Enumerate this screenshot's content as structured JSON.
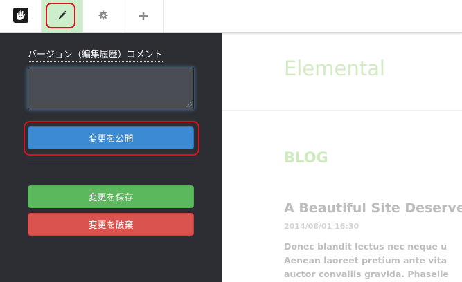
{
  "toolbar": {
    "logo_icon": "concrete5-hand-icon",
    "edit_icon": "pencil-icon",
    "settings_icon": "gear-icon",
    "add_icon": "plus-icon",
    "active_color": "#cdeeca",
    "highlight_color": "#d8131d"
  },
  "panel": {
    "version_comment_label": "バージョン（編集履歴）コメント",
    "comment_value": "",
    "publish_label": "変更を公開",
    "save_label": "変更を保存",
    "discard_label": "変更を破棄",
    "colors": {
      "publish": "#3b8ad2",
      "save": "#5cb85c",
      "discard": "#d9534f",
      "background": "#2c2e33"
    }
  },
  "site": {
    "title": "Elemental",
    "section_heading": "BLOG",
    "post": {
      "title": "A Beautiful Site Deserve",
      "date": "2014/08/01 16:30",
      "excerpt_lines": [
        "Donec blandit lectus nec neque u",
        "Aenean laoreet pretium ante vita",
        "auctor convallis gravida. Phaselle"
      ]
    }
  }
}
